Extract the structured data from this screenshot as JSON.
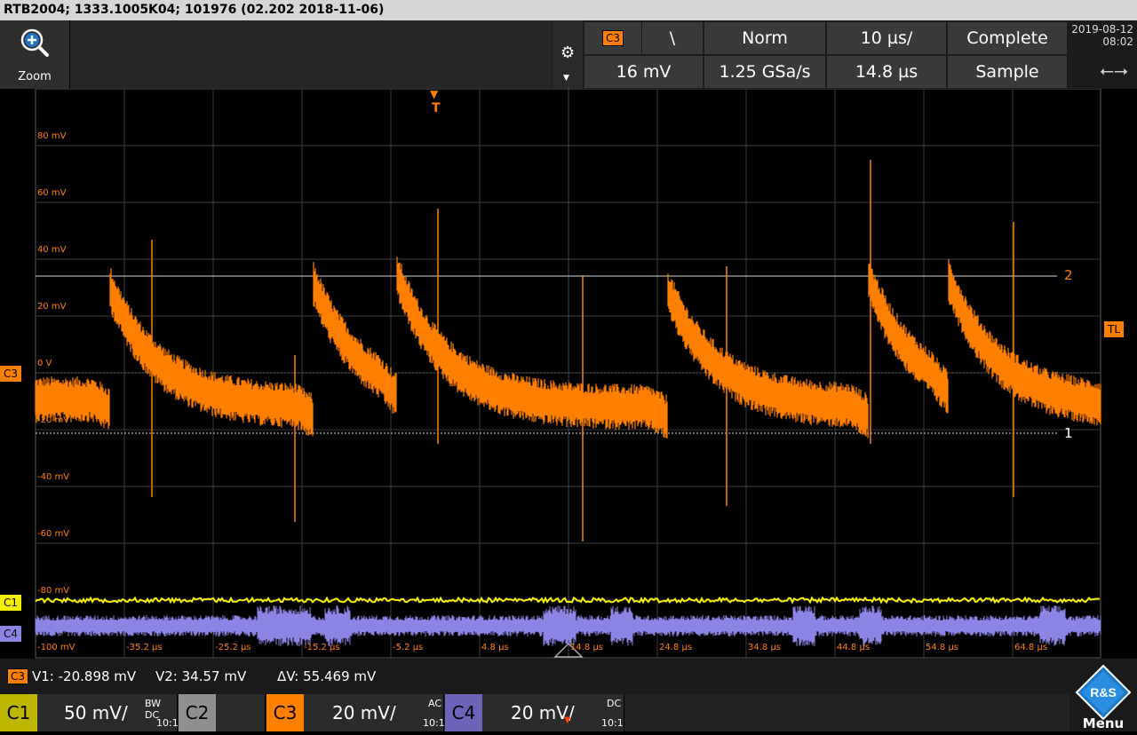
{
  "title": "RTB2004; 1333.1005K04; 101976 (02.202 2018-11-06)",
  "toolbar": {
    "zoom_label": "Zoom",
    "trigger_source": "C3",
    "trigger_slope": "\\",
    "trigger_mode": "Norm",
    "time_scale": "10 µs/",
    "acq_state": "Complete",
    "trigger_level": "16 mV",
    "sample_rate": "1.25 GSa/s",
    "trigger_pos": "14.8 µs",
    "acq_mode": "Sample",
    "date": "2019-08-12",
    "time": "08:02"
  },
  "markers": {
    "trigger_top": "T",
    "cursor2": "2",
    "cursor1": "1",
    "trigger_level": "TL",
    "c3": "C3",
    "c1": "C1",
    "c4": "C4"
  },
  "v_labels": [
    "80 mV",
    "60 mV",
    "40 mV",
    "20 mV",
    "0 V",
    "-20 mV",
    "-40 mV",
    "-60 mV",
    "-80 mV",
    "-100 mV"
  ],
  "t_labels": [
    "-35.2 µs",
    "-25.2 µs",
    "-15.2 µs",
    "-5.2 µs",
    "4.8 µs",
    "14.8 µs",
    "24.8 µs",
    "34.8 µs",
    "44.8 µs",
    "54.8 µs",
    "64.8 µs"
  ],
  "measurement": {
    "source": "C3",
    "v1": "V1: -20.898 mV",
    "v2": "V2: 34.57 mV",
    "dv": "ΔV: 55.469 mV"
  },
  "channels": {
    "c1": {
      "name": "C1",
      "scale": "50 mV/",
      "coupling": "BW DC",
      "probe": "10:1"
    },
    "c2": {
      "name": "C2"
    },
    "c3": {
      "name": "C3",
      "scale": "20 mV/",
      "coupling": "AC",
      "probe": "10:1"
    },
    "c4": {
      "name": "C4",
      "scale": "20 mV/",
      "coupling": "DC",
      "probe": "10:1"
    }
  },
  "menu_label": "Menu",
  "logo_text": "R&S",
  "colors": {
    "c1": "#f5f000",
    "c3": "#ff8000",
    "c4": "#8c85e6",
    "c2": "#9a9a9a"
  }
}
